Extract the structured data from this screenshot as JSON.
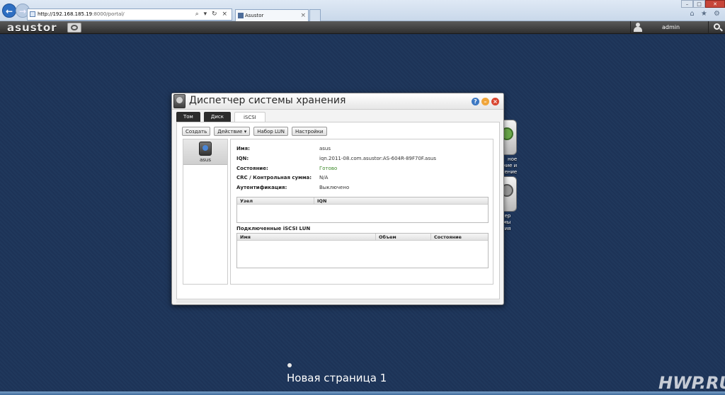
{
  "browser": {
    "url_host": "http://192.168.185.19",
    "url_rest": ":8000/portal/",
    "tab_title": "Asustor",
    "addr_tools": "⌕ ▾ ↻ ×",
    "win_min": "–",
    "win_max": "□",
    "win_close": "✕",
    "tools": "⌂ ★ ⚙"
  },
  "adm": {
    "logo": "asustor",
    "username": "admin"
  },
  "window": {
    "title": "Диспетчер системы хранения",
    "help": "?",
    "minimize": "–",
    "close": "×",
    "tabs": [
      "Том",
      "Диск",
      "iSCSI"
    ],
    "toolbar": [
      "Создать",
      "Действие ▾",
      "Набор LUN",
      "Настройки"
    ],
    "lun_label": "asus",
    "details": [
      {
        "key": "Имя:",
        "value": "asus"
      },
      {
        "key": "IQN:",
        "value": "iqn.2011-08.com.asustor:AS-604R-89F70F.asus"
      },
      {
        "key": "Состояние:",
        "value": "Готово"
      },
      {
        "key": "CRC / Контрольная сумма:",
        "value": "N/A"
      },
      {
        "key": "Аутентификация:",
        "value": "Выключено"
      }
    ],
    "nodes_table": {
      "columns": [
        "Узел",
        "IQN"
      ]
    },
    "luns_title": "Подключенные iSCSI LUN",
    "luns_table": {
      "columns": [
        "Имя",
        "Объем",
        "Состояние"
      ]
    }
  },
  "desktop": {
    "icon1_label": "ное\nние и\nление",
    "icon2_label": "нер\nмы\nния",
    "page_label": "Новая страница 1",
    "watermark": "HWP.RU"
  }
}
